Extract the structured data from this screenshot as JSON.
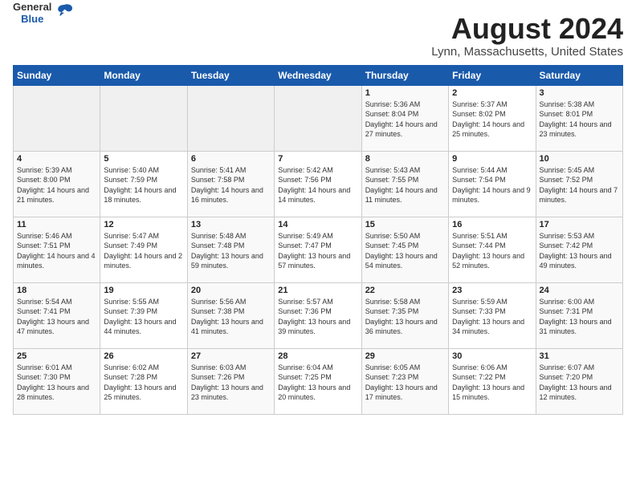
{
  "header": {
    "logo_general": "General",
    "logo_blue": "Blue",
    "month_title": "August 2024",
    "location": "Lynn, Massachusetts, United States"
  },
  "columns": [
    "Sunday",
    "Monday",
    "Tuesday",
    "Wednesday",
    "Thursday",
    "Friday",
    "Saturday"
  ],
  "weeks": [
    [
      {
        "day": "",
        "text": ""
      },
      {
        "day": "",
        "text": ""
      },
      {
        "day": "",
        "text": ""
      },
      {
        "day": "",
        "text": ""
      },
      {
        "day": "1",
        "text": "Sunrise: 5:36 AM\nSunset: 8:04 PM\nDaylight: 14 hours and 27 minutes."
      },
      {
        "day": "2",
        "text": "Sunrise: 5:37 AM\nSunset: 8:02 PM\nDaylight: 14 hours and 25 minutes."
      },
      {
        "day": "3",
        "text": "Sunrise: 5:38 AM\nSunset: 8:01 PM\nDaylight: 14 hours and 23 minutes."
      }
    ],
    [
      {
        "day": "4",
        "text": "Sunrise: 5:39 AM\nSunset: 8:00 PM\nDaylight: 14 hours and 21 minutes."
      },
      {
        "day": "5",
        "text": "Sunrise: 5:40 AM\nSunset: 7:59 PM\nDaylight: 14 hours and 18 minutes."
      },
      {
        "day": "6",
        "text": "Sunrise: 5:41 AM\nSunset: 7:58 PM\nDaylight: 14 hours and 16 minutes."
      },
      {
        "day": "7",
        "text": "Sunrise: 5:42 AM\nSunset: 7:56 PM\nDaylight: 14 hours and 14 minutes."
      },
      {
        "day": "8",
        "text": "Sunrise: 5:43 AM\nSunset: 7:55 PM\nDaylight: 14 hours and 11 minutes."
      },
      {
        "day": "9",
        "text": "Sunrise: 5:44 AM\nSunset: 7:54 PM\nDaylight: 14 hours and 9 minutes."
      },
      {
        "day": "10",
        "text": "Sunrise: 5:45 AM\nSunset: 7:52 PM\nDaylight: 14 hours and 7 minutes."
      }
    ],
    [
      {
        "day": "11",
        "text": "Sunrise: 5:46 AM\nSunset: 7:51 PM\nDaylight: 14 hours and 4 minutes."
      },
      {
        "day": "12",
        "text": "Sunrise: 5:47 AM\nSunset: 7:49 PM\nDaylight: 14 hours and 2 minutes."
      },
      {
        "day": "13",
        "text": "Sunrise: 5:48 AM\nSunset: 7:48 PM\nDaylight: 13 hours and 59 minutes."
      },
      {
        "day": "14",
        "text": "Sunrise: 5:49 AM\nSunset: 7:47 PM\nDaylight: 13 hours and 57 minutes."
      },
      {
        "day": "15",
        "text": "Sunrise: 5:50 AM\nSunset: 7:45 PM\nDaylight: 13 hours and 54 minutes."
      },
      {
        "day": "16",
        "text": "Sunrise: 5:51 AM\nSunset: 7:44 PM\nDaylight: 13 hours and 52 minutes."
      },
      {
        "day": "17",
        "text": "Sunrise: 5:53 AM\nSunset: 7:42 PM\nDaylight: 13 hours and 49 minutes."
      }
    ],
    [
      {
        "day": "18",
        "text": "Sunrise: 5:54 AM\nSunset: 7:41 PM\nDaylight: 13 hours and 47 minutes."
      },
      {
        "day": "19",
        "text": "Sunrise: 5:55 AM\nSunset: 7:39 PM\nDaylight: 13 hours and 44 minutes."
      },
      {
        "day": "20",
        "text": "Sunrise: 5:56 AM\nSunset: 7:38 PM\nDaylight: 13 hours and 41 minutes."
      },
      {
        "day": "21",
        "text": "Sunrise: 5:57 AM\nSunset: 7:36 PM\nDaylight: 13 hours and 39 minutes."
      },
      {
        "day": "22",
        "text": "Sunrise: 5:58 AM\nSunset: 7:35 PM\nDaylight: 13 hours and 36 minutes."
      },
      {
        "day": "23",
        "text": "Sunrise: 5:59 AM\nSunset: 7:33 PM\nDaylight: 13 hours and 34 minutes."
      },
      {
        "day": "24",
        "text": "Sunrise: 6:00 AM\nSunset: 7:31 PM\nDaylight: 13 hours and 31 minutes."
      }
    ],
    [
      {
        "day": "25",
        "text": "Sunrise: 6:01 AM\nSunset: 7:30 PM\nDaylight: 13 hours and 28 minutes."
      },
      {
        "day": "26",
        "text": "Sunrise: 6:02 AM\nSunset: 7:28 PM\nDaylight: 13 hours and 25 minutes."
      },
      {
        "day": "27",
        "text": "Sunrise: 6:03 AM\nSunset: 7:26 PM\nDaylight: 13 hours and 23 minutes."
      },
      {
        "day": "28",
        "text": "Sunrise: 6:04 AM\nSunset: 7:25 PM\nDaylight: 13 hours and 20 minutes."
      },
      {
        "day": "29",
        "text": "Sunrise: 6:05 AM\nSunset: 7:23 PM\nDaylight: 13 hours and 17 minutes."
      },
      {
        "day": "30",
        "text": "Sunrise: 6:06 AM\nSunset: 7:22 PM\nDaylight: 13 hours and 15 minutes."
      },
      {
        "day": "31",
        "text": "Sunrise: 6:07 AM\nSunset: 7:20 PM\nDaylight: 13 hours and 12 minutes."
      }
    ]
  ]
}
